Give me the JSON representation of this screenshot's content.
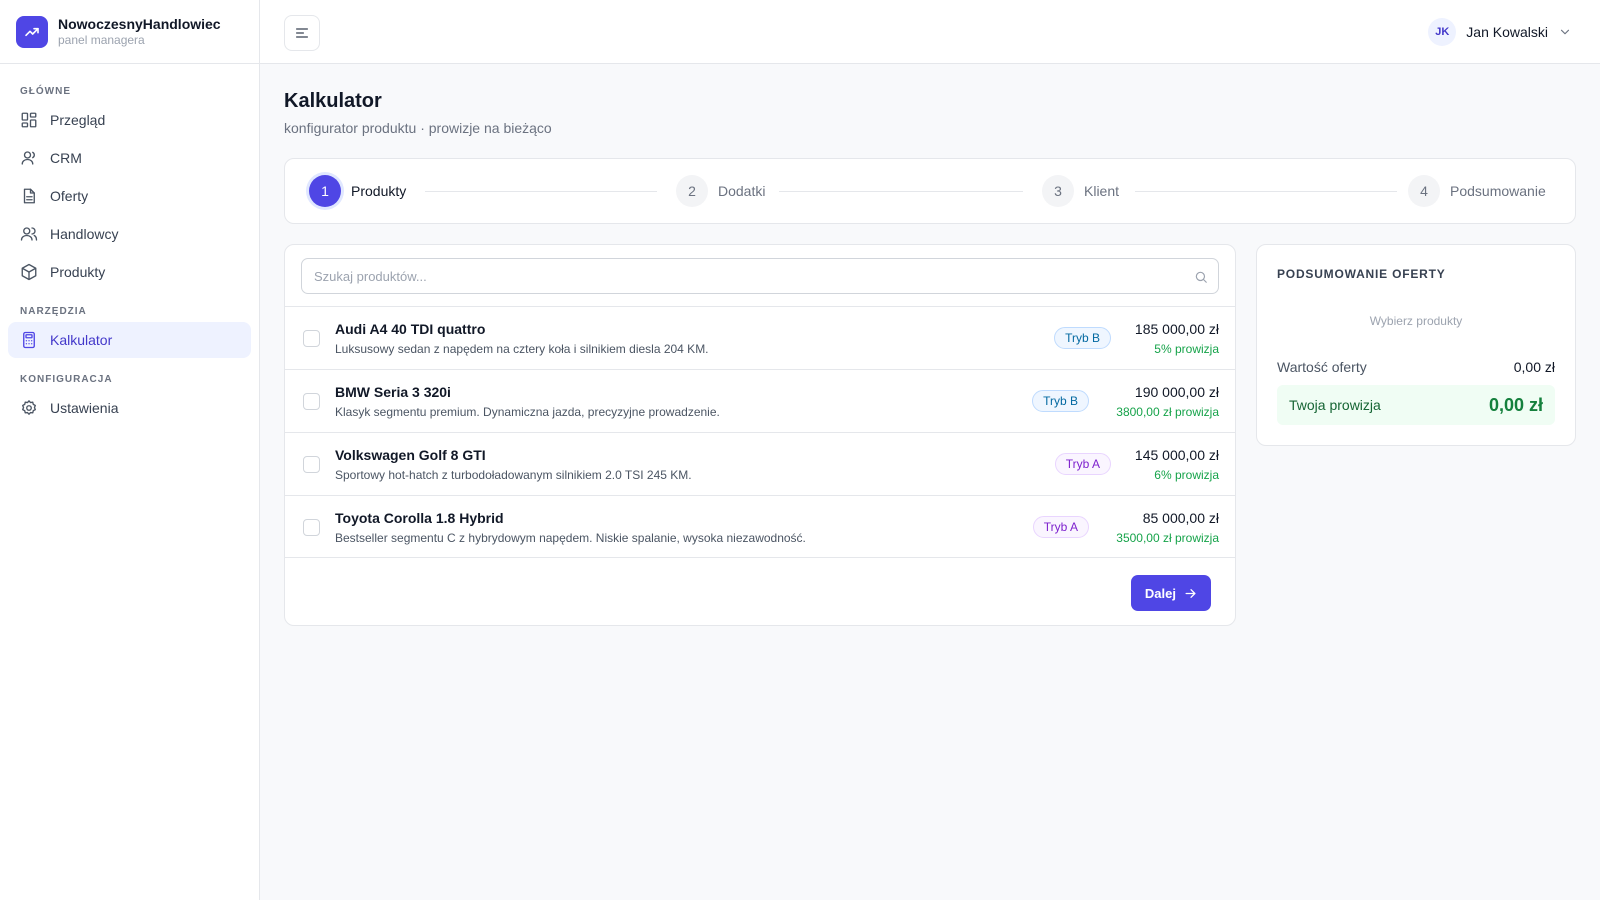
{
  "brand": {
    "name": "NowoczesnyHandlowiec",
    "subtitle": "panel managera"
  },
  "colors": {
    "accent": "#4f46e5",
    "success": "#16a34a",
    "mode_b": "#0369a1",
    "mode_a": "#7e22ce"
  },
  "sidebar": {
    "sections": [
      {
        "title": "GŁÓWNE",
        "items": [
          {
            "label": "Przegląd",
            "icon": "dashboard-icon"
          },
          {
            "label": "CRM",
            "icon": "user-icon"
          },
          {
            "label": "Oferty",
            "icon": "document-icon"
          },
          {
            "label": "Handlowcy",
            "icon": "users-icon"
          },
          {
            "label": "Produkty",
            "icon": "box-icon"
          }
        ]
      },
      {
        "title": "NARZĘDZIA",
        "items": [
          {
            "label": "Kalkulator",
            "icon": "calculator-icon",
            "active": true
          }
        ]
      },
      {
        "title": "KONFIGURACJA",
        "items": [
          {
            "label": "Ustawienia",
            "icon": "gear-icon"
          }
        ]
      }
    ]
  },
  "topbar": {
    "user_initials": "JK",
    "user_name": "Jan Kowalski"
  },
  "page": {
    "title": "Kalkulator",
    "subtitle": "konfigurator produktu · prowizje na bieżąco"
  },
  "stepper": {
    "steps": [
      {
        "number": "1",
        "label": "Produkty",
        "active": true
      },
      {
        "number": "2",
        "label": "Dodatki"
      },
      {
        "number": "3",
        "label": "Klient"
      },
      {
        "number": "4",
        "label": "Podsumowanie"
      }
    ]
  },
  "search": {
    "placeholder": "Szukaj produktów...",
    "value": ""
  },
  "products": [
    {
      "name": "Audi A4 40 TDI quattro",
      "description": "Luksusowy sedan z napędem na cztery koła i silnikiem diesla 204 KM.",
      "mode": "Tryb B",
      "price": "185 000,00 zł",
      "commission": "5% prowizja"
    },
    {
      "name": "BMW Seria 3 320i",
      "description": "Klasyk segmentu premium. Dynamiczna jazda, precyzyjne prowadzenie.",
      "mode": "Tryb B",
      "price": "190 000,00 zł",
      "commission": "3800,00 zł prowizja"
    },
    {
      "name": "Volkswagen Golf 8 GTI",
      "description": "Sportowy hot-hatch z turbodoładowanym silnikiem 2.0 TSI 245 KM.",
      "mode": "Tryb A",
      "price": "145 000,00 zł",
      "commission": "6% prowizja"
    },
    {
      "name": "Toyota Corolla 1.8 Hybrid",
      "description": "Bestseller segmentu C z hybrydowym napędem. Niskie spalanie, wysoka niezawodność.",
      "mode": "Tryb A",
      "price": "85 000,00 zł",
      "commission": "3500,00 zł prowizja"
    }
  ],
  "actions": {
    "next_label": "Dalej"
  },
  "summary": {
    "title": "PODSUMOWANIE OFERTY",
    "empty_text": "Wybierz produkty",
    "offer_value_label": "Wartość oferty",
    "offer_value": "0,00 zł",
    "commission_label": "Twoja prowizja",
    "commission_value": "0,00 zł"
  }
}
